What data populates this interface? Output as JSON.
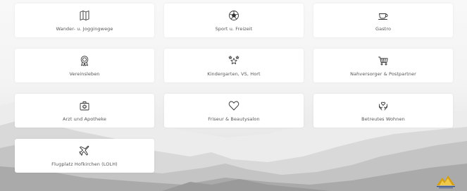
{
  "tiles": [
    {
      "label": "Wander- u. Joggingwege",
      "icon": "map-icon"
    },
    {
      "label": "Sport u. Freizeit",
      "icon": "soccer-ball-icon"
    },
    {
      "label": "Gastro",
      "icon": "coffee-cup-icon"
    },
    {
      "label": "Vereinsleben",
      "icon": "award-badge-icon"
    },
    {
      "label": "Kindergarten, VS, Hort",
      "icon": "stars-icon"
    },
    {
      "label": "Nahversorger & Postpartner",
      "icon": "shopping-cart-icon"
    },
    {
      "label": "Arzt und Apotheke",
      "icon": "first-aid-kit-icon"
    },
    {
      "label": "Friseur & Beautysalon",
      "icon": "heart-icon"
    },
    {
      "label": "Betreutes Wohnen",
      "icon": "care-hands-icon"
    },
    {
      "label": "Flugplatz Hofkirchen (LOLH)",
      "icon": "airplane-icon"
    }
  ],
  "colors": {
    "icon": "#333333",
    "label": "#555555",
    "tile": "#ffffff",
    "logo_gold": "#d4a017"
  }
}
